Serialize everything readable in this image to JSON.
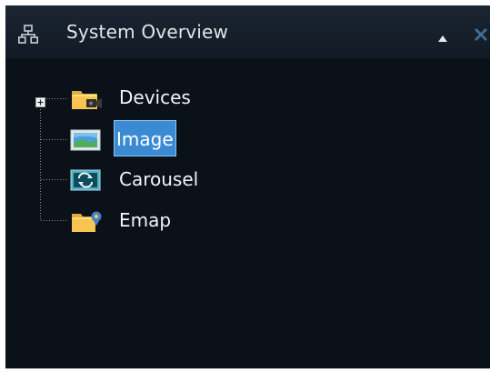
{
  "panel": {
    "title": "System Overview",
    "header_icon": "network-icon",
    "collapse_icon": "triangle-up-icon",
    "close_icon": "close-icon"
  },
  "tree": {
    "items": [
      {
        "label": "Devices",
        "icon": "folder-camera-icon",
        "expandable": true,
        "selected": false
      },
      {
        "label": "Image",
        "icon": "image-icon",
        "expandable": false,
        "selected": true
      },
      {
        "label": "Carousel",
        "icon": "carousel-icon",
        "expandable": false,
        "selected": false
      },
      {
        "label": "Emap",
        "icon": "emap-folder-icon",
        "expandable": false,
        "selected": false
      }
    ]
  },
  "colors": {
    "background": "#0b1119",
    "header": "#151e29",
    "text": "#f2f4f6",
    "selection": "#3a8ad4"
  }
}
